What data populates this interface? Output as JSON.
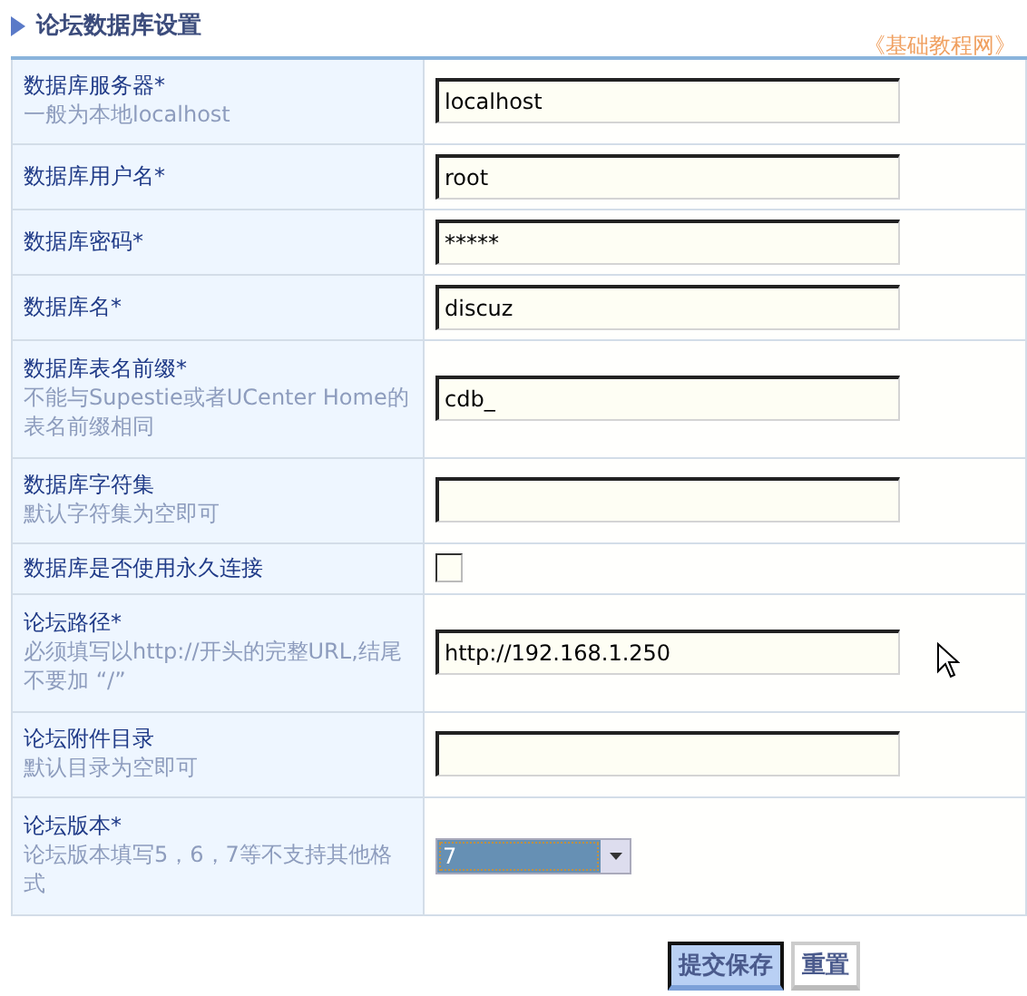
{
  "title": "论坛数据库设置",
  "site_link": "《基础教程网》",
  "rows": [
    {
      "label": "数据库服务器*",
      "hint": "一般为本地localhost",
      "kind": "text",
      "value": "localhost"
    },
    {
      "label": "数据库用户名*",
      "kind": "text",
      "value": "root"
    },
    {
      "label": "数据库密码*",
      "kind": "password",
      "value": "*****"
    },
    {
      "label": "数据库名*",
      "kind": "text",
      "value": "discuz"
    },
    {
      "label": "数据库表名前缀*",
      "hint": "不能与Supestie或者UCenter Home的表名前缀相同",
      "kind": "text",
      "value": "cdb_"
    },
    {
      "label": "数据库字符集",
      "hint": "默认字符集为空即可",
      "kind": "text"
    },
    {
      "label": "数据库是否使用永久连接",
      "kind": "checkbox",
      "checked": false
    },
    {
      "label": "论坛路径*",
      "hint": "必须填写以http://开头的完整URL,结尾不要加 “/”",
      "kind": "text",
      "value": "http://192.168.1.250"
    },
    {
      "label": "论坛附件目录",
      "hint": "默认目录为空即可",
      "kind": "text"
    },
    {
      "label": "论坛版本*",
      "hint": "论坛版本填写5，6，7等不支持其他格式",
      "kind": "select",
      "value": "7"
    }
  ],
  "buttons": [
    {
      "label": "提交保存",
      "kind": "primary"
    },
    {
      "label": "重置",
      "kind": "secondary"
    }
  ]
}
